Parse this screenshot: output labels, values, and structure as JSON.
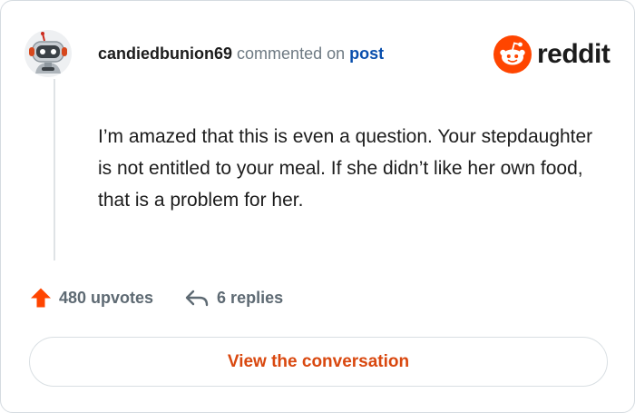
{
  "comment": {
    "username": "candiedbunion69",
    "action_text": "commented on",
    "post_link": "post",
    "body": "I’m amazed that this is even a question. Your stepdaughter is not entitled to your meal. If she didn’t like her own food, that is a problem for her."
  },
  "brand": {
    "name": "reddit",
    "icon": "reddit-snoo-icon",
    "accent_color": "#ff4500"
  },
  "stats": {
    "upvotes_label": "480 upvotes",
    "replies_label": "6 replies",
    "upvote_icon": "upvote-arrow-icon",
    "reply_icon": "reply-arrow-icon"
  },
  "cta": {
    "label": "View the conversation"
  },
  "avatar": {
    "icon": "robot-avatar-icon"
  }
}
